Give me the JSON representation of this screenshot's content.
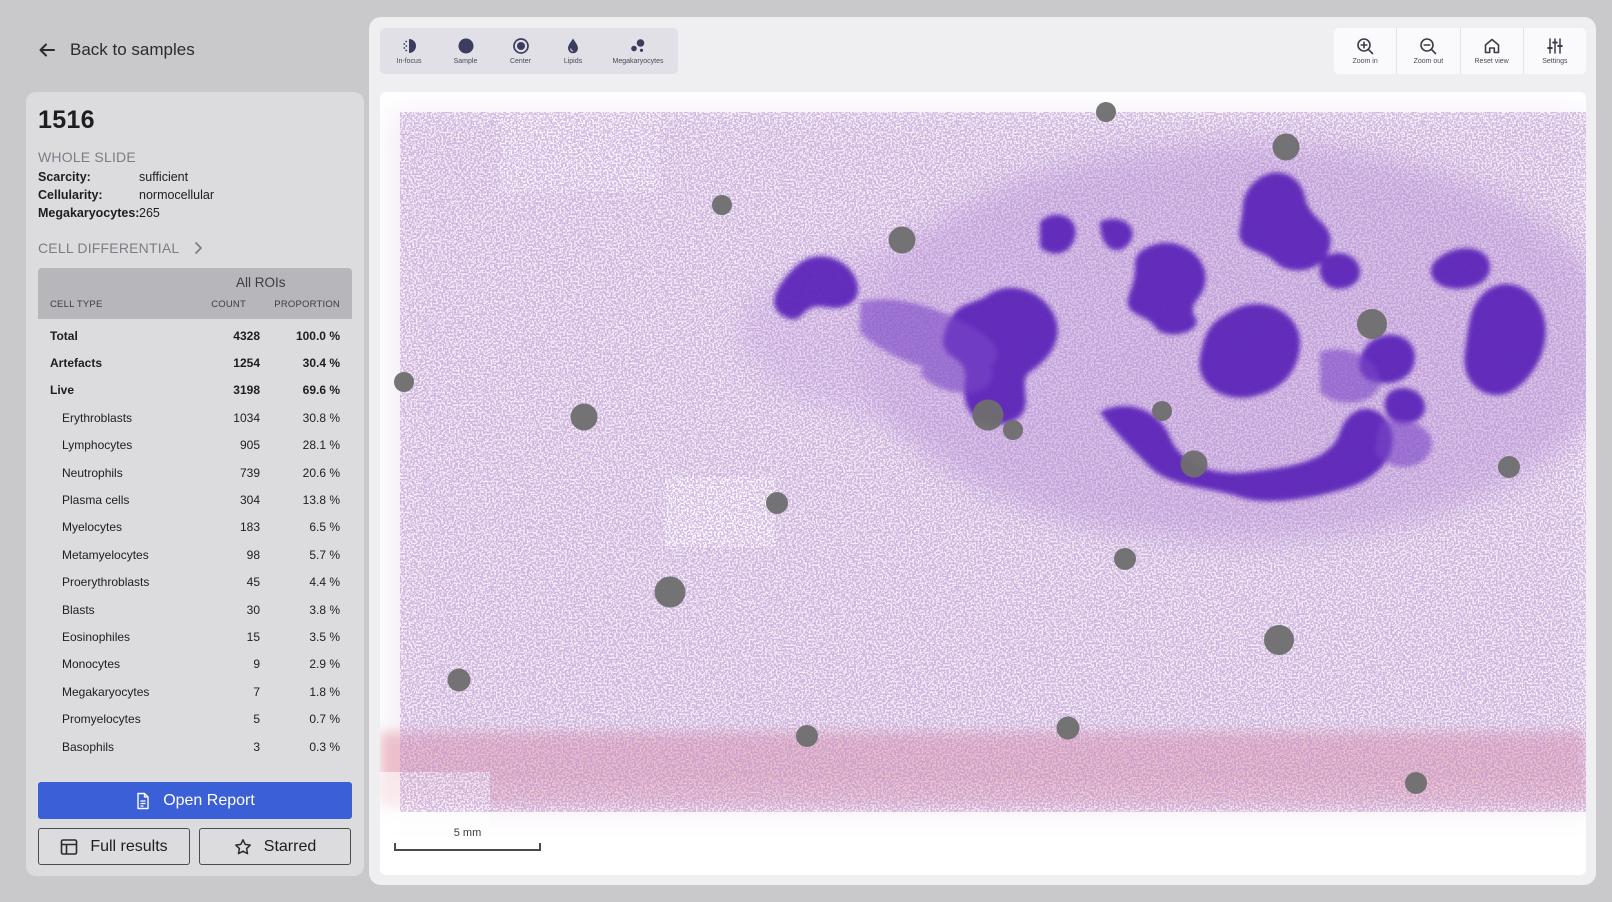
{
  "nav": {
    "back_label": "Back to samples"
  },
  "sample": {
    "id": "1516",
    "whole_slide_title": "WHOLE SLIDE",
    "fields": [
      {
        "key": "Scarcity:",
        "value": "sufficient"
      },
      {
        "key": "Cellularity:",
        "value": "normocellular"
      },
      {
        "key": "Megakaryocytes:",
        "value": "265"
      }
    ]
  },
  "differential": {
    "title": "CELL DIFFERENTIAL",
    "group_label": "All ROIs",
    "headers": {
      "cell_type": "CELL TYPE",
      "count": "COUNT",
      "proportion": "PROPORTION"
    },
    "rows": [
      {
        "name": "Total",
        "count": "4328",
        "proportion": "100.0 %",
        "level": "top"
      },
      {
        "name": "Artefacts",
        "count": "1254",
        "proportion": "30.4 %",
        "level": "top"
      },
      {
        "name": "Live",
        "count": "3198",
        "proportion": "69.6 %",
        "level": "top"
      },
      {
        "name": "Erythroblasts",
        "count": "1034",
        "proportion": "30.8 %",
        "level": "sub"
      },
      {
        "name": "Lymphocytes",
        "count": "905",
        "proportion": "28.1 %",
        "level": "sub"
      },
      {
        "name": "Neutrophils",
        "count": "739",
        "proportion": "20.6 %",
        "level": "sub"
      },
      {
        "name": "Plasma cells",
        "count": "304",
        "proportion": "13.8 %",
        "level": "sub"
      },
      {
        "name": "Myelocytes",
        "count": "183",
        "proportion": "6.5 %",
        "level": "sub"
      },
      {
        "name": "Metamyelocytes",
        "count": "98",
        "proportion": "5.7 %",
        "level": "sub"
      },
      {
        "name": "Proerythroblasts",
        "count": "45",
        "proportion": "4.4 %",
        "level": "sub"
      },
      {
        "name": "Blasts",
        "count": "30",
        "proportion": "3.8 %",
        "level": "sub"
      },
      {
        "name": "Eosinophiles",
        "count": "15",
        "proportion": "3.5 %",
        "level": "sub"
      },
      {
        "name": "Monocytes",
        "count": "9",
        "proportion": "2.9 %",
        "level": "sub"
      },
      {
        "name": "Megakaryocytes",
        "count": "7",
        "proportion": "1.8 %",
        "level": "sub"
      },
      {
        "name": "Promyelocytes",
        "count": "5",
        "proportion": "0.7 %",
        "level": "sub"
      },
      {
        "name": "Basophils",
        "count": "3",
        "proportion": "0.3 %",
        "level": "sub"
      }
    ]
  },
  "actions": {
    "open_report": "Open Report",
    "full_results": "Full results",
    "starred": "Starred"
  },
  "viewer": {
    "layer_tools": [
      {
        "label": "In-focus",
        "icon": "in-focus-icon"
      },
      {
        "label": "Sample",
        "icon": "sample-icon"
      },
      {
        "label": "Center",
        "icon": "center-icon"
      },
      {
        "label": "Lipids",
        "icon": "lipids-icon"
      },
      {
        "label": "Megakaryocytes",
        "icon": "megakaryocytes-icon"
      }
    ],
    "view_tools": [
      {
        "label": "Zoom in",
        "icon": "zoom-in-icon"
      },
      {
        "label": "Zoom out",
        "icon": "zoom-out-icon"
      },
      {
        "label": "Reset view",
        "icon": "home-icon"
      },
      {
        "label": "Settings",
        "icon": "sliders-icon"
      }
    ],
    "scale_label": "5 mm"
  },
  "colors": {
    "primary": "#3a5fd6",
    "stain_purple": "#5a22b8",
    "stain_pink": "#e9b7c4",
    "marker": "#6e6e6e"
  }
}
